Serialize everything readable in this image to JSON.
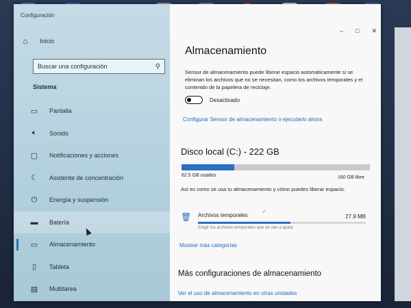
{
  "window": {
    "app_title": "Configuración",
    "controls": {
      "minimize": "–",
      "maximize": "□",
      "close": "✕"
    }
  },
  "sidebar": {
    "home_label": "Inicio",
    "search_placeholder": "Buscar una configuración",
    "section_title": "Sistema",
    "items": [
      {
        "label": "Pantalla",
        "icon": "monitor-icon"
      },
      {
        "label": "Sonido",
        "icon": "speaker-icon"
      },
      {
        "label": "Notificaciones y acciones",
        "icon": "notification-icon"
      },
      {
        "label": "Asistente de concentración",
        "icon": "moon-icon"
      },
      {
        "label": "Energía y suspensión",
        "icon": "power-icon"
      },
      {
        "label": "Batería",
        "icon": "battery-icon"
      },
      {
        "label": "Almacenamiento",
        "icon": "storage-icon"
      },
      {
        "label": "Tableta",
        "icon": "tablet-icon"
      },
      {
        "label": "Multitarea",
        "icon": "multitask-icon"
      }
    ],
    "selected_index": 6,
    "hover_index": 5
  },
  "main": {
    "title": "Almacenamiento",
    "storage_sense_desc": "Sensor de almacenamiento puede liberar espacio automáticamente si se eliminan los archivos que no se necesitan, como los archivos temporales y el contenido de la papelera de reciclaje.",
    "toggle_state_label": "Desactivado",
    "toggle_on": false,
    "configure_link": "Configurar Sensor de almacenamiento o ejecutarlo ahora",
    "disk": {
      "title": "Disco local (C:) - 222 GB",
      "used_label": "62.5 GB usados",
      "free_label": "160 GB libre",
      "used_fraction": 0.28
    },
    "usage_desc": "Así es como se usa tu almacenamiento y cómo puedes liberar espacio.",
    "temp_files": {
      "label": "Archivos temporales",
      "size": "27.9 MB",
      "subtext": "Elegir los archivos temporales que se van a quitar",
      "fill_fraction": 0.55
    },
    "more_categories_link": "Mostrar más categorías",
    "more_settings_title": "Más configuraciones de almacenamiento",
    "other_drives_link": "Ver el uso de almacenamiento en otras unidades"
  },
  "colors": {
    "accent": "#2a6fc1",
    "link": "#1f6bb6",
    "sidebar_bg": "#b3d0dd"
  }
}
